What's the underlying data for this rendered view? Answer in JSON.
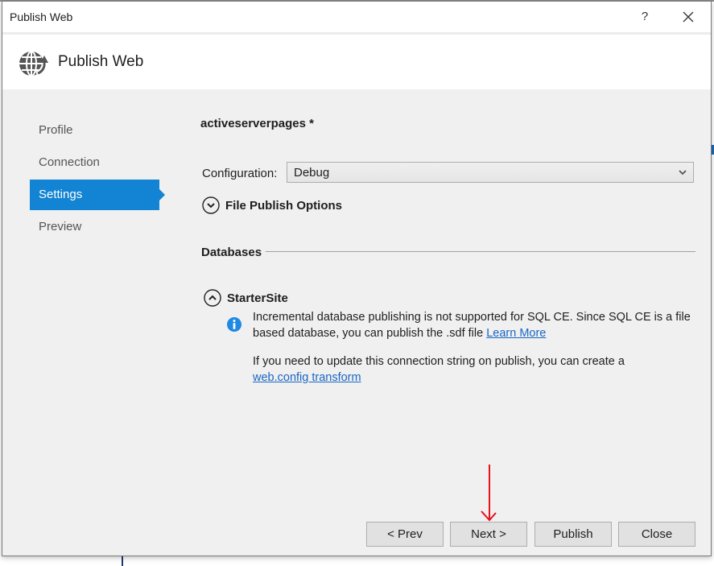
{
  "window": {
    "title": "Publish Web",
    "help_label": "?",
    "close_label": "close"
  },
  "header": {
    "title": "Publish Web",
    "icon": "globe-publish-icon"
  },
  "nav": {
    "items": [
      {
        "label": "Profile",
        "active": false
      },
      {
        "label": "Connection",
        "active": false
      },
      {
        "label": "Settings",
        "active": true
      },
      {
        "label": "Preview",
        "active": false
      }
    ]
  },
  "settings": {
    "profile_name": "activeserverpages *",
    "configuration_label": "Configuration:",
    "configuration_value": "Debug",
    "file_publish_options_label": "File Publish Options",
    "databases_label": "Databases",
    "database": {
      "name": "StarterSite",
      "info_text_1": "Incremental database publishing is not supported for SQL CE. Since SQL CE is a file based database, you can publish the .sdf file",
      "info_link_1": "Learn More",
      "info_text_2": "If you need to update this connection string on publish, you can create a",
      "info_link_2": "web.config transform"
    }
  },
  "footer": {
    "prev_label": "< Prev",
    "next_label": "Next >",
    "publish_label": "Publish",
    "close_label": "Close"
  },
  "annotation": {
    "arrow_color": "#e8101a"
  },
  "colors": {
    "accent": "#1284d3",
    "link": "#1a66c4",
    "dialog_bg": "#f0f0f0"
  }
}
